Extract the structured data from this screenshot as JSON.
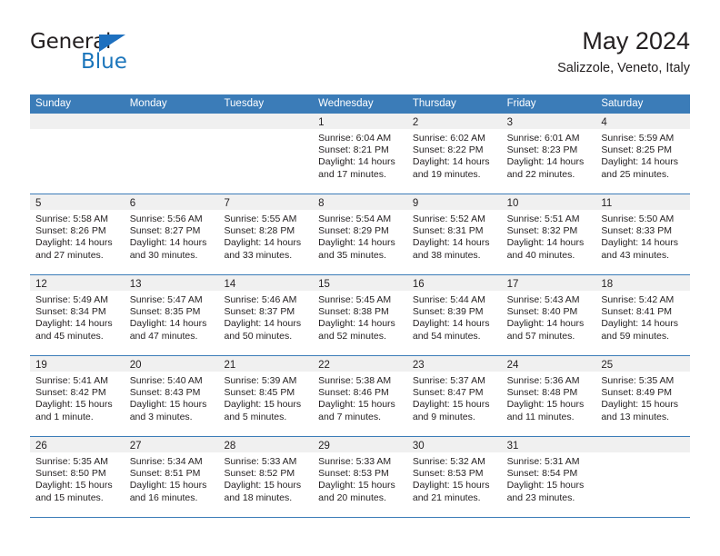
{
  "brand": {
    "name_top": "General",
    "name_bottom": "Blue",
    "accent_color": "#1b75bb",
    "triangle_color": "#1e70bf"
  },
  "header": {
    "title": "May 2024",
    "subtitle": "Salizzole, Veneto, Italy"
  },
  "calendar": {
    "header_bg": "#3b7cb8",
    "datebar_bg": "#f0f0f0",
    "weekdays": [
      "Sunday",
      "Monday",
      "Tuesday",
      "Wednesday",
      "Thursday",
      "Friday",
      "Saturday"
    ],
    "weeks": [
      [
        {
          "day": "",
          "lines": []
        },
        {
          "day": "",
          "lines": []
        },
        {
          "day": "",
          "lines": []
        },
        {
          "day": "1",
          "lines": [
            "Sunrise: 6:04 AM",
            "Sunset: 8:21 PM",
            "Daylight: 14 hours",
            "and 17 minutes."
          ]
        },
        {
          "day": "2",
          "lines": [
            "Sunrise: 6:02 AM",
            "Sunset: 8:22 PM",
            "Daylight: 14 hours",
            "and 19 minutes."
          ]
        },
        {
          "day": "3",
          "lines": [
            "Sunrise: 6:01 AM",
            "Sunset: 8:23 PM",
            "Daylight: 14 hours",
            "and 22 minutes."
          ]
        },
        {
          "day": "4",
          "lines": [
            "Sunrise: 5:59 AM",
            "Sunset: 8:25 PM",
            "Daylight: 14 hours",
            "and 25 minutes."
          ]
        }
      ],
      [
        {
          "day": "5",
          "lines": [
            "Sunrise: 5:58 AM",
            "Sunset: 8:26 PM",
            "Daylight: 14 hours",
            "and 27 minutes."
          ]
        },
        {
          "day": "6",
          "lines": [
            "Sunrise: 5:56 AM",
            "Sunset: 8:27 PM",
            "Daylight: 14 hours",
            "and 30 minutes."
          ]
        },
        {
          "day": "7",
          "lines": [
            "Sunrise: 5:55 AM",
            "Sunset: 8:28 PM",
            "Daylight: 14 hours",
            "and 33 minutes."
          ]
        },
        {
          "day": "8",
          "lines": [
            "Sunrise: 5:54 AM",
            "Sunset: 8:29 PM",
            "Daylight: 14 hours",
            "and 35 minutes."
          ]
        },
        {
          "day": "9",
          "lines": [
            "Sunrise: 5:52 AM",
            "Sunset: 8:31 PM",
            "Daylight: 14 hours",
            "and 38 minutes."
          ]
        },
        {
          "day": "10",
          "lines": [
            "Sunrise: 5:51 AM",
            "Sunset: 8:32 PM",
            "Daylight: 14 hours",
            "and 40 minutes."
          ]
        },
        {
          "day": "11",
          "lines": [
            "Sunrise: 5:50 AM",
            "Sunset: 8:33 PM",
            "Daylight: 14 hours",
            "and 43 minutes."
          ]
        }
      ],
      [
        {
          "day": "12",
          "lines": [
            "Sunrise: 5:49 AM",
            "Sunset: 8:34 PM",
            "Daylight: 14 hours",
            "and 45 minutes."
          ]
        },
        {
          "day": "13",
          "lines": [
            "Sunrise: 5:47 AM",
            "Sunset: 8:35 PM",
            "Daylight: 14 hours",
            "and 47 minutes."
          ]
        },
        {
          "day": "14",
          "lines": [
            "Sunrise: 5:46 AM",
            "Sunset: 8:37 PM",
            "Daylight: 14 hours",
            "and 50 minutes."
          ]
        },
        {
          "day": "15",
          "lines": [
            "Sunrise: 5:45 AM",
            "Sunset: 8:38 PM",
            "Daylight: 14 hours",
            "and 52 minutes."
          ]
        },
        {
          "day": "16",
          "lines": [
            "Sunrise: 5:44 AM",
            "Sunset: 8:39 PM",
            "Daylight: 14 hours",
            "and 54 minutes."
          ]
        },
        {
          "day": "17",
          "lines": [
            "Sunrise: 5:43 AM",
            "Sunset: 8:40 PM",
            "Daylight: 14 hours",
            "and 57 minutes."
          ]
        },
        {
          "day": "18",
          "lines": [
            "Sunrise: 5:42 AM",
            "Sunset: 8:41 PM",
            "Daylight: 14 hours",
            "and 59 minutes."
          ]
        }
      ],
      [
        {
          "day": "19",
          "lines": [
            "Sunrise: 5:41 AM",
            "Sunset: 8:42 PM",
            "Daylight: 15 hours",
            "and 1 minute."
          ]
        },
        {
          "day": "20",
          "lines": [
            "Sunrise: 5:40 AM",
            "Sunset: 8:43 PM",
            "Daylight: 15 hours",
            "and 3 minutes."
          ]
        },
        {
          "day": "21",
          "lines": [
            "Sunrise: 5:39 AM",
            "Sunset: 8:45 PM",
            "Daylight: 15 hours",
            "and 5 minutes."
          ]
        },
        {
          "day": "22",
          "lines": [
            "Sunrise: 5:38 AM",
            "Sunset: 8:46 PM",
            "Daylight: 15 hours",
            "and 7 minutes."
          ]
        },
        {
          "day": "23",
          "lines": [
            "Sunrise: 5:37 AM",
            "Sunset: 8:47 PM",
            "Daylight: 15 hours",
            "and 9 minutes."
          ]
        },
        {
          "day": "24",
          "lines": [
            "Sunrise: 5:36 AM",
            "Sunset: 8:48 PM",
            "Daylight: 15 hours",
            "and 11 minutes."
          ]
        },
        {
          "day": "25",
          "lines": [
            "Sunrise: 5:35 AM",
            "Sunset: 8:49 PM",
            "Daylight: 15 hours",
            "and 13 minutes."
          ]
        }
      ],
      [
        {
          "day": "26",
          "lines": [
            "Sunrise: 5:35 AM",
            "Sunset: 8:50 PM",
            "Daylight: 15 hours",
            "and 15 minutes."
          ]
        },
        {
          "day": "27",
          "lines": [
            "Sunrise: 5:34 AM",
            "Sunset: 8:51 PM",
            "Daylight: 15 hours",
            "and 16 minutes."
          ]
        },
        {
          "day": "28",
          "lines": [
            "Sunrise: 5:33 AM",
            "Sunset: 8:52 PM",
            "Daylight: 15 hours",
            "and 18 minutes."
          ]
        },
        {
          "day": "29",
          "lines": [
            "Sunrise: 5:33 AM",
            "Sunset: 8:53 PM",
            "Daylight: 15 hours",
            "and 20 minutes."
          ]
        },
        {
          "day": "30",
          "lines": [
            "Sunrise: 5:32 AM",
            "Sunset: 8:53 PM",
            "Daylight: 15 hours",
            "and 21 minutes."
          ]
        },
        {
          "day": "31",
          "lines": [
            "Sunrise: 5:31 AM",
            "Sunset: 8:54 PM",
            "Daylight: 15 hours",
            "and 23 minutes."
          ]
        },
        {
          "day": "",
          "lines": []
        }
      ]
    ]
  }
}
